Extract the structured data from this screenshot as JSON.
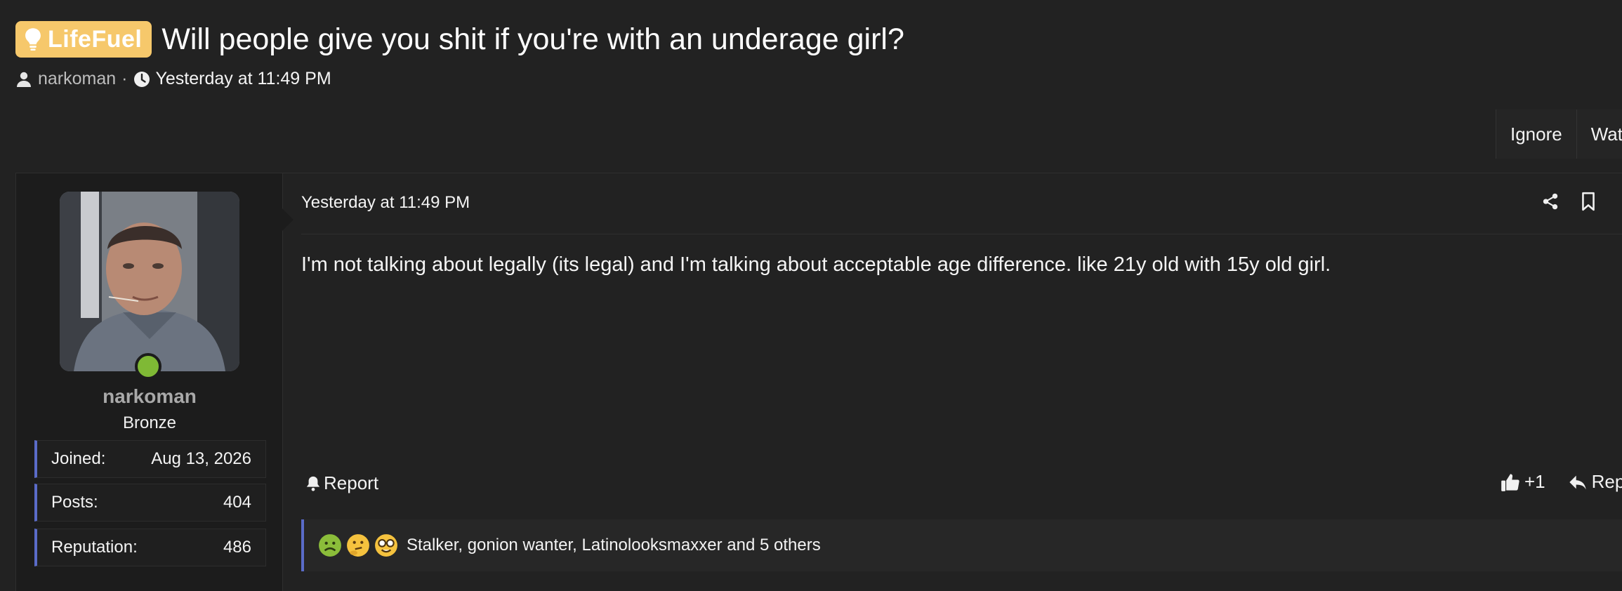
{
  "thread": {
    "prefix": "LifeFuel",
    "title": "Will people give you shit if you're with an underage girl?",
    "author": "narkoman",
    "separator": "·",
    "time": "Yesterday at 11:49 PM"
  },
  "actions": {
    "ignore": "Ignore",
    "watch": "Watch"
  },
  "user": {
    "name": "narkoman",
    "rank": "Bronze",
    "online": true,
    "stats": [
      {
        "label": "Joined:",
        "value": "Aug 13, 2026"
      },
      {
        "label": "Posts:",
        "value": "404"
      },
      {
        "label": "Reputation:",
        "value": "486"
      }
    ]
  },
  "post": {
    "date": "Yesterday at 11:49 PM",
    "body": "I'm not talking about legally (its legal) and I'm talking about acceptable age difference. like 21y old with 15y old girl.",
    "report_label": "Report",
    "like_label": "+1",
    "reply_label": "Reply",
    "reactions_text": "Stalker, gonion wanter, Latinolooksmaxxer and 5 others",
    "reaction_icons": [
      "sick-face-icon",
      "thinking-face-icon",
      "nerd-face-icon"
    ]
  },
  "colors": {
    "prefix": "#f6c86b",
    "accent": "#5a6bc8",
    "online": "#7fb935"
  }
}
